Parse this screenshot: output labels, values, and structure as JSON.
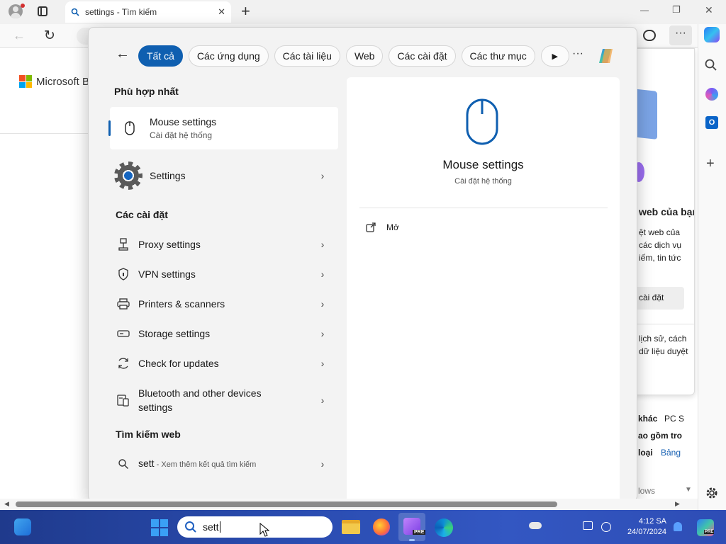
{
  "browser": {
    "tab_title": "settings - Tìm kiếm",
    "new_tab_label": "+",
    "minimize_label": "—",
    "restore_label": "❐",
    "close_label": "✕"
  },
  "bing_page": {
    "brand": "Microsoft B",
    "flyout_lines": [
      "web của bạn",
      "ệt web của",
      "các dịch vụ",
      "iếm, tin tức",
      "cài đặt",
      "lịch sử, cách",
      "dữ liệu duyệt"
    ],
    "under_lines": [
      "khác",
      "PC S",
      "ao gồm tro",
      "loại",
      "Bảng",
      "lows"
    ]
  },
  "search_panel": {
    "back_label": "←",
    "filters": [
      "Tất cả",
      "Các ứng dụng",
      "Các tài liệu",
      "Web",
      "Các cài đặt",
      "Các thư mục"
    ],
    "more_label": "···",
    "best_match_heading": "Phù hợp nhất",
    "best_match": {
      "title": "Mouse settings",
      "subtitle": "Cài đặt hệ thống"
    },
    "settings_app": {
      "title": "Settings"
    },
    "settings_heading": "Các cài đặt",
    "settings_items": [
      {
        "label": "Proxy settings",
        "icon": "proxy-icon"
      },
      {
        "label": "VPN settings",
        "icon": "vpn-shield-icon"
      },
      {
        "label": "Printers & scanners",
        "icon": "printer-icon"
      },
      {
        "label": "Storage settings",
        "icon": "storage-icon"
      },
      {
        "label": "Check for updates",
        "icon": "update-icon"
      },
      {
        "label": "Bluetooth and other devices settings",
        "icon": "bluetooth-devices-icon"
      }
    ],
    "web_heading": "Tìm kiếm web",
    "web_query": "sett",
    "web_query_suffix": " - Xem thêm kết quả tìm kiếm",
    "detail": {
      "title": "Mouse settings",
      "subtitle": "Cài đặt hệ thống",
      "open_label": "Mở"
    }
  },
  "taskbar": {
    "search_value": "sett",
    "time": "4:12 SA",
    "date": "24/07/2024",
    "pre_badge": "PRE"
  },
  "colors": {
    "accent": "#0f5fb0",
    "taskbar": "#2a4cb0"
  }
}
